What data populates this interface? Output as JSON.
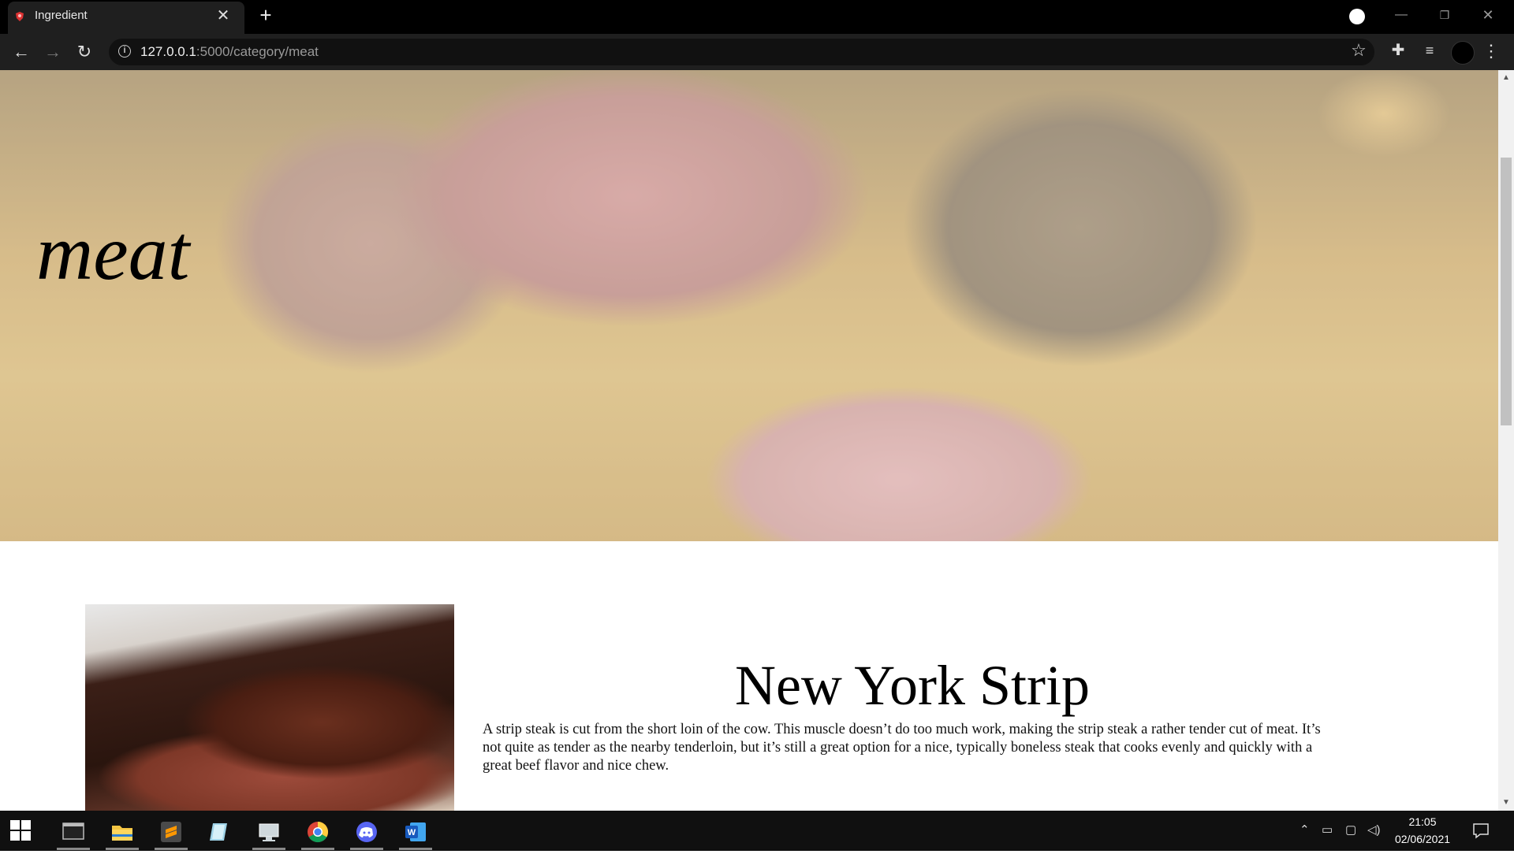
{
  "browser": {
    "tab_title": "Ingredient",
    "url_host": "127.0.0.1",
    "url_rest": ":5000/category/meat",
    "tab_close_glyph": "✕",
    "new_tab_glyph": "+"
  },
  "page": {
    "hero_title": "meat",
    "item": {
      "title": "New York Strip",
      "description": "A strip steak is cut from the short loin of the cow. This muscle doesn’t do too much work, making the strip steak a rather tender cut of meat. It’s not quite as tender as the nearby tenderloin, but it’s still a great option for a nice, typically boneless steak that cooks evenly and quickly with a great beef flavor and nice chew."
    }
  },
  "taskbar": {
    "apps": [
      "terminal-icon",
      "file-explorer-icon",
      "sublime-text-icon",
      "notes-icon",
      "pc-settings-icon",
      "chrome-icon",
      "discord-icon",
      "word-icon"
    ],
    "time": "21:05",
    "date": "02/06/2021"
  },
  "colors": {
    "titlebar": "#000000",
    "toolbar": "#1f1f1f",
    "taskbar": "#101010"
  }
}
